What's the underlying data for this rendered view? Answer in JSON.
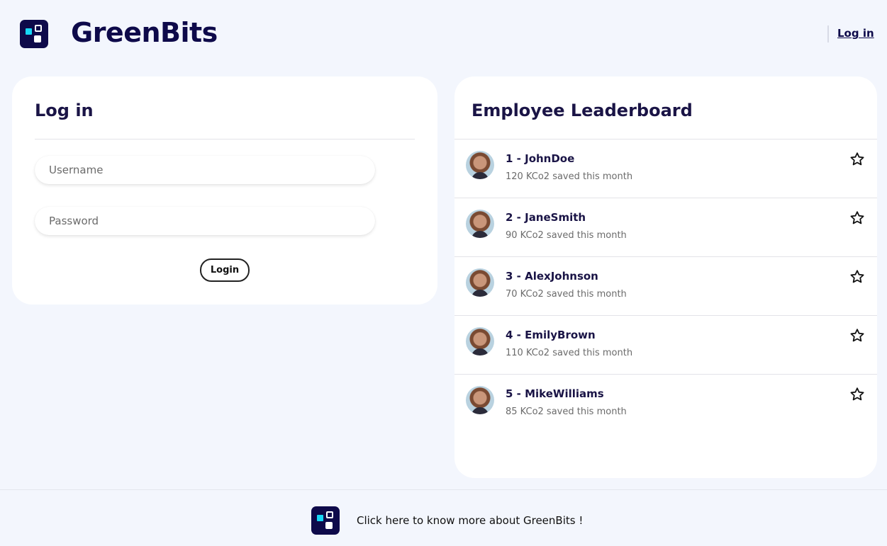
{
  "header": {
    "brand": "GreenBits",
    "login_link": "Log in"
  },
  "login": {
    "title": "Log in",
    "username_placeholder": "Username",
    "password_placeholder": "Password",
    "button_label": "Login"
  },
  "leaderboard": {
    "title": "Employee Leaderboard",
    "rows": [
      {
        "name": "1 - JohnDoe",
        "detail": "120 KCo2 saved this month"
      },
      {
        "name": "2 - JaneSmith",
        "detail": "90 KCo2 saved this month"
      },
      {
        "name": "3 - AlexJohnson",
        "detail": "70 KCo2 saved this month"
      },
      {
        "name": "4 - EmilyBrown",
        "detail": "110 KCo2 saved this month"
      },
      {
        "name": "5 - MikeWilliams",
        "detail": "85 KCo2 saved this month"
      }
    ],
    "row_icon": "star-outline-icon"
  },
  "footer": {
    "link_text": "Click here to know more about GreenBits !"
  },
  "colors": {
    "page_bg": "#f3f6fd",
    "brand_navy": "#0e0a4a",
    "logo_accent": "#17d7f5"
  }
}
